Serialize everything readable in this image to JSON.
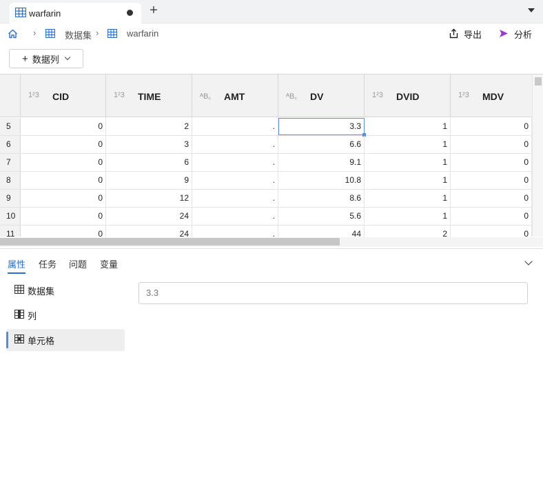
{
  "tab": {
    "title": "warfarin",
    "add_label": "+"
  },
  "breadcrumb": {
    "dataset_label": "数据集",
    "table_label": "warfarin",
    "sep": "›"
  },
  "toolbar": {
    "export_label": "导出",
    "analyze_label": "分析",
    "add_column_label": "数据列",
    "add_plus": "+"
  },
  "colors": {
    "accent": "#2a6fcc",
    "selection": "#5a8fe0",
    "analyze_icon": "#9b3ad8",
    "header_bg": "#f2f2f2"
  },
  "grid": {
    "columns": [
      {
        "name": "CID",
        "type": "1²3"
      },
      {
        "name": "TIME",
        "type": "1²3"
      },
      {
        "name": "AMT",
        "type": "ᴬB꜀"
      },
      {
        "name": "DV",
        "type": "ᴬB꜀"
      },
      {
        "name": "DVID",
        "type": "1²3"
      },
      {
        "name": "MDV",
        "type": "1²3"
      }
    ],
    "rows": [
      {
        "num": "5",
        "cells": [
          "0",
          "2",
          ".",
          "3.3",
          "1",
          "0"
        ]
      },
      {
        "num": "6",
        "cells": [
          "0",
          "3",
          ".",
          "6.6",
          "1",
          "0"
        ]
      },
      {
        "num": "7",
        "cells": [
          "0",
          "6",
          ".",
          "9.1",
          "1",
          "0"
        ]
      },
      {
        "num": "8",
        "cells": [
          "0",
          "9",
          ".",
          "10.8",
          "1",
          "0"
        ]
      },
      {
        "num": "9",
        "cells": [
          "0",
          "12",
          ".",
          "8.6",
          "1",
          "0"
        ]
      },
      {
        "num": "10",
        "cells": [
          "0",
          "24",
          ".",
          "5.6",
          "1",
          "0"
        ]
      },
      {
        "num": "11",
        "cells": [
          "0",
          "24",
          ".",
          "44",
          "2",
          "0"
        ]
      }
    ],
    "selected_cell": {
      "row": 0,
      "col": 3
    }
  },
  "panel": {
    "tabs": [
      "属性",
      "任务",
      "问题",
      "变量"
    ],
    "active_tab": 0,
    "nav": [
      {
        "label": "数据集",
        "icon": "table-icon"
      },
      {
        "label": "列",
        "icon": "column-icon"
      },
      {
        "label": "单元格",
        "icon": "cell-icon"
      }
    ],
    "active_nav": 2,
    "cell_value": "3.3"
  }
}
